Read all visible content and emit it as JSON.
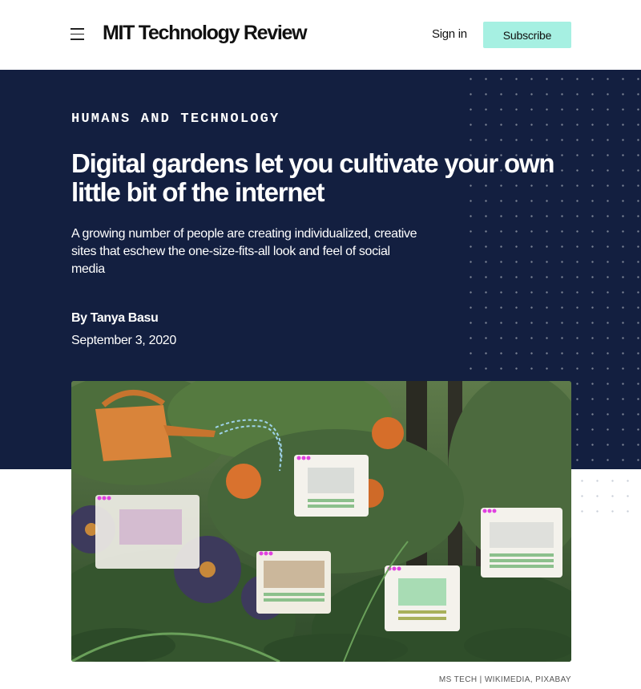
{
  "header": {
    "logo": "MIT Technology Review",
    "signin_label": "Sign in",
    "subscribe_label": "Subscribe"
  },
  "article": {
    "kicker": "HUMANS AND TECHNOLOGY",
    "headline": "Digital gardens let you cultivate your own little bit of the internet",
    "dek": "A growing number of people are creating individualized, creative sites that eschew the one-size-fits-all look and feel of social media",
    "byline_prefix": "By ",
    "author": "Tanya Basu",
    "date": "September 3, 2020"
  },
  "image": {
    "credit": "MS TECH | WIKIMEDIA, PIXABAY"
  },
  "colors": {
    "hero_bg": "#131f40",
    "subscribe_bg": "#a6f0e2"
  },
  "icons": [
    "menu-icon"
  ]
}
